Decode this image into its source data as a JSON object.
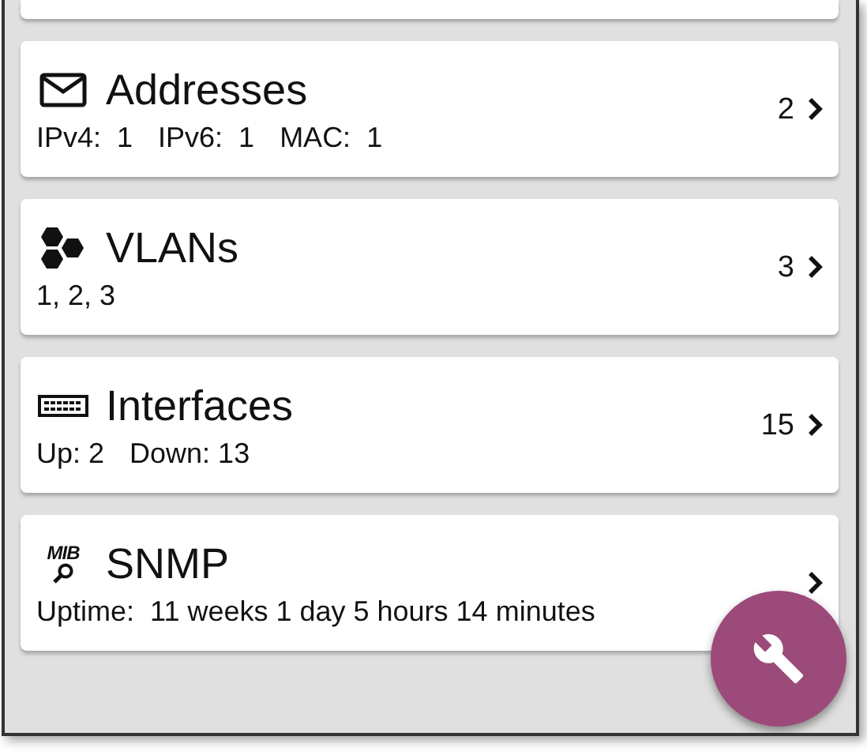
{
  "cards": [
    {
      "kind": "addresses",
      "title": "Addresses",
      "details": [
        "IPv4:  1",
        "IPv6:  1",
        "MAC:  1"
      ],
      "count": "2"
    },
    {
      "kind": "vlans",
      "title": "VLANs",
      "details": [
        "1, 2, 3"
      ],
      "count": "3"
    },
    {
      "kind": "interfaces",
      "title": "Interfaces",
      "details": [
        "Up: 2",
        "Down: 13"
      ],
      "count": "15"
    },
    {
      "kind": "snmp",
      "title": "SNMP",
      "icon_text": "MIB",
      "details": [
        "Uptime:  11 weeks 1 day 5 hours 14 minutes"
      ]
    }
  ]
}
